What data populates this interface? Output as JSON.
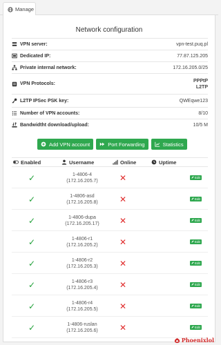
{
  "tab": {
    "label": "Manage",
    "icon": "globe-icon"
  },
  "title": "Network configuration",
  "info": [
    {
      "icon": "server-icon",
      "label": "VPN server:",
      "value": "vpn-test.puq.pl"
    },
    {
      "icon": "ip-icon",
      "label": "Dedicated IP:",
      "value": "77.87.125.205"
    },
    {
      "icon": "network-icon",
      "label": "Private internal network:",
      "value": "172.16.205.0/25"
    },
    {
      "icon": "protocol-icon",
      "label": "VPN Protocols:",
      "value": "PPPtP",
      "value2": "L2TP"
    },
    {
      "icon": "key-icon",
      "label": "L2TP IPSec PSK key:",
      "value": "QWEqwe123"
    },
    {
      "icon": "list-icon",
      "label": "Number of VPN accounts:",
      "value": "8/10"
    },
    {
      "icon": "bandwidth-icon",
      "label": "Bandwidtht download/upload:",
      "value": "10/5 M"
    }
  ],
  "actions": [
    {
      "icon": "plus-circle-icon",
      "label": "Add VPN account"
    },
    {
      "icon": "forward-icon",
      "label": "Port Forwarding"
    },
    {
      "icon": "chart-icon",
      "label": "Statistics"
    }
  ],
  "table": {
    "headers": {
      "enabled": "Enabled",
      "username": "Username",
      "online": "Online",
      "uptime": "Uptime"
    },
    "edit_label": "Edit",
    "rows": [
      {
        "user": "1-4806-4",
        "ip": "(172.16.205.7)"
      },
      {
        "user": "1-4806-asd",
        "ip": "(172.16.205.8)"
      },
      {
        "user": "1-4806-dupa",
        "ip": "(172.16.205.17)"
      },
      {
        "user": "1-4806-r1",
        "ip": "(172.16.205.2)"
      },
      {
        "user": "1-4806-r2",
        "ip": "(172.16.205.3)"
      },
      {
        "user": "1-4806-r3",
        "ip": "(172.16.205.4)"
      },
      {
        "user": "1-4806-r4",
        "ip": "(172.16.205.5)"
      },
      {
        "user": "1-4806-ruslan",
        "ip": "(172.16.205.6)"
      }
    ]
  },
  "brand": {
    "name": "Phoenixlol"
  },
  "colors": {
    "accent": "#2fa84f",
    "enabled": "#22a13a",
    "offline": "#e02b2b",
    "brand": "#d12b2b"
  }
}
